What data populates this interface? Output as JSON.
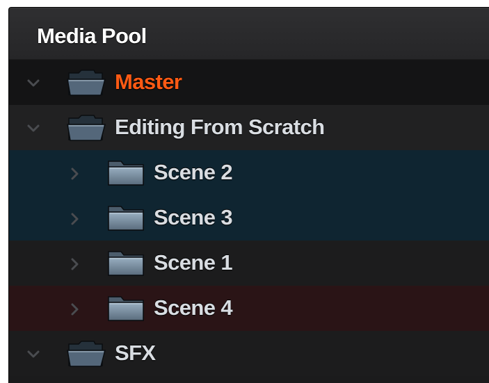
{
  "panel": {
    "title": "Media Pool"
  },
  "colors": {
    "master_label": "#ff5a14",
    "label": "#d9dde2",
    "row_default": "#1c1c1d",
    "row_alt": "#212122",
    "row_master": "#141415",
    "row_selected": "#0f2531",
    "row_red": "#2a1416"
  },
  "bins": [
    {
      "label": "Master",
      "expanded": true,
      "level": 0,
      "state": "master",
      "icon": "open-folder-icon"
    },
    {
      "label": "Editing From Scratch",
      "expanded": true,
      "level": 0,
      "state": "normal",
      "icon": "open-folder-icon"
    },
    {
      "label": "Scene 2",
      "expanded": false,
      "level": 1,
      "state": "selected",
      "icon": "folder-icon"
    },
    {
      "label": "Scene 3",
      "expanded": false,
      "level": 1,
      "state": "selected",
      "icon": "folder-icon"
    },
    {
      "label": "Scene 1",
      "expanded": false,
      "level": 1,
      "state": "normal",
      "icon": "folder-icon"
    },
    {
      "label": "Scene 4",
      "expanded": false,
      "level": 1,
      "state": "red",
      "icon": "folder-icon"
    },
    {
      "label": "SFX",
      "expanded": true,
      "level": 0,
      "state": "normal",
      "icon": "open-folder-icon"
    }
  ]
}
